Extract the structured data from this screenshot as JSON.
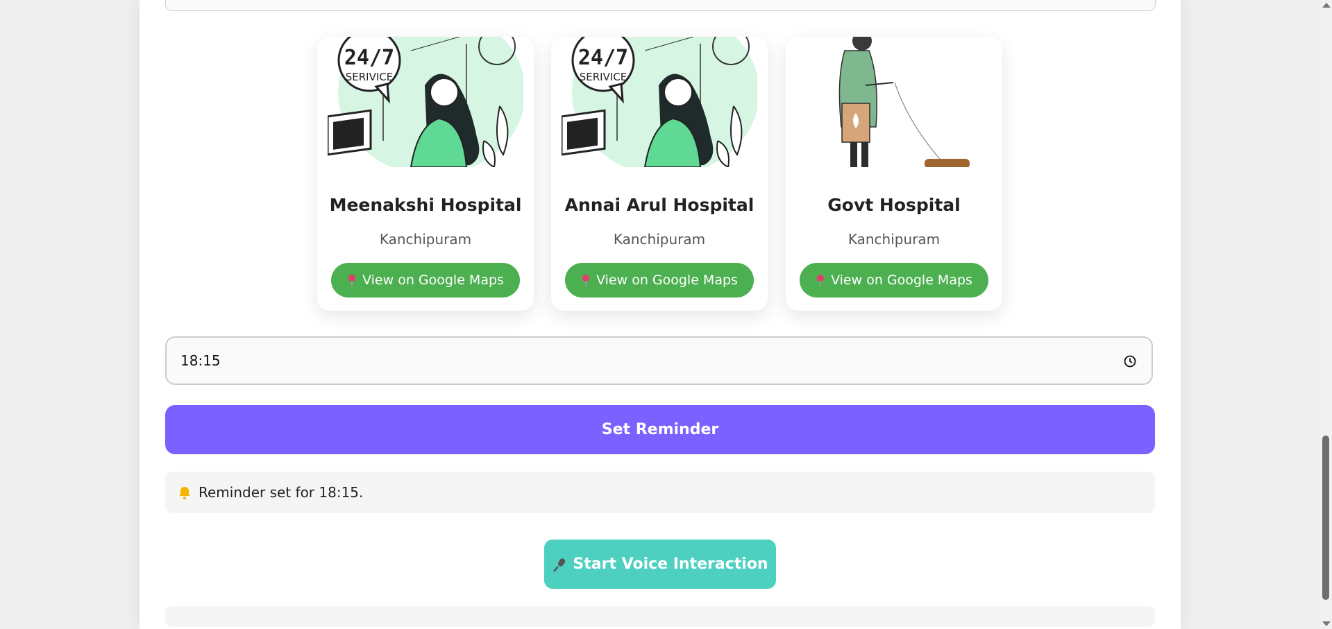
{
  "hospitals": [
    {
      "name": "Meenakshi Hospital",
      "city": "Kanchipuram",
      "maps_label": "View on Google Maps",
      "illustration": "24-7-service-agent",
      "badge_line1": "24/7",
      "badge_line2": "SERIVICE"
    },
    {
      "name": "Annai Arul Hospital",
      "city": "Kanchipuram",
      "maps_label": "View on Google Maps",
      "illustration": "24-7-service-agent",
      "badge_line1": "24/7",
      "badge_line2": "SERIVICE"
    },
    {
      "name": "Govt Hospital",
      "city": "Kanchipuram",
      "maps_label": "View on Google Maps",
      "illustration": "person-walking-dog"
    }
  ],
  "reminder": {
    "time_value": "18:15",
    "button_label": "Set Reminder",
    "status_text": "Reminder set for 18:15."
  },
  "voice": {
    "button_label": "Start Voice Interaction"
  },
  "colors": {
    "maps_button": "#4caf50",
    "reminder_button": "#7b61ff",
    "voice_button": "#4dd0c0",
    "illustration_accent": "#5fd993"
  },
  "icons": {
    "pin": "pin-icon",
    "clock": "clock-icon",
    "bell": "bell-icon",
    "mic": "microphone-icon"
  }
}
